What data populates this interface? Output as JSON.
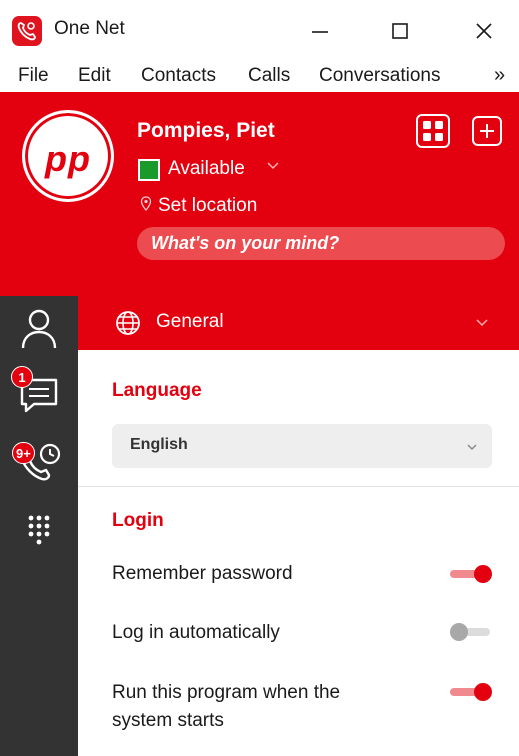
{
  "app": {
    "title": "One Net"
  },
  "menu": {
    "items": [
      "File",
      "Edit",
      "Contacts",
      "Calls",
      "Conversations"
    ],
    "more": "»"
  },
  "profile": {
    "initials": "pp",
    "name": "Pompies, Piet",
    "status": "Available",
    "status_color": "#1a9a2a",
    "location": "Set location",
    "mind_placeholder": "What's on your mind?"
  },
  "rail": {
    "items": [
      {
        "icon": "person-icon",
        "badge": ""
      },
      {
        "icon": "chat-icon",
        "badge": "1"
      },
      {
        "icon": "call-history-icon",
        "badge": "9+"
      },
      {
        "icon": "dialpad-icon",
        "badge": ""
      }
    ]
  },
  "section": {
    "title": "General",
    "icon": "globe-icon"
  },
  "language": {
    "heading": "Language",
    "selected": "English"
  },
  "login": {
    "heading": "Login",
    "settings": [
      {
        "label": "Remember password",
        "enabled": true
      },
      {
        "label": "Log in automatically",
        "enabled": false
      },
      {
        "label": "Run this program when the system starts",
        "enabled": true
      }
    ]
  },
  "colors": {
    "brand": "#e3000f",
    "rail": "#333333"
  }
}
